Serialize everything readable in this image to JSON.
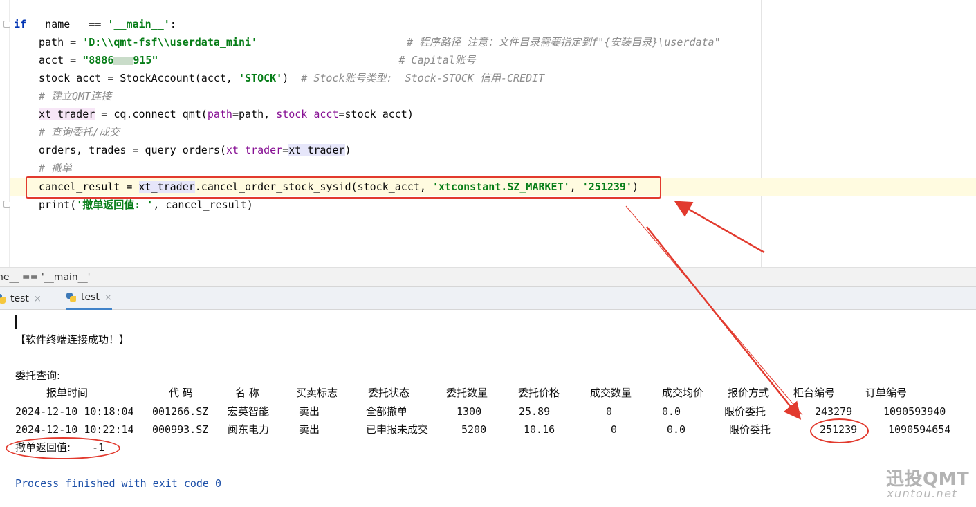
{
  "editor": {
    "line1": {
      "kw": "if",
      "mid": " __name__ == ",
      "str": "'__main__'",
      "tail": ":"
    },
    "line2": {
      "pre": "path = ",
      "str": "'D:\\\\qmt-fsf\\\\userdata_mini'",
      "comment": "# 程序路径 注意：文件目录需要指定到f\"{安装目录}\\userdata\""
    },
    "line3": {
      "pre": "acct = ",
      "str_a": "\"8886",
      "str_b": "915\"",
      "comment": "# Capital账号"
    },
    "line4": {
      "pre": "stock_acct = StockAccount(acct, ",
      "str": "'STOCK'",
      "mid": ")  ",
      "comment": "# Stock账号类型:  Stock-STOCK 信用-CREDIT"
    },
    "line5": {
      "comment": "# 建立QMT连接"
    },
    "line6": {
      "var": "xt_trader",
      "a": " = cq.connect_qmt(",
      "p1": "path",
      "b": "=path, ",
      "p2": "stock_acct",
      "c": "=stock_acct)"
    },
    "line7": {
      "comment": "# 查询委托/成交"
    },
    "line8": {
      "a": "orders, trades = query_orders(",
      "p1": "xt_trader",
      "b": "=",
      "v": "xt_trader",
      "c": ")"
    },
    "line9": {
      "comment": "# 撤单"
    },
    "line10": {
      "a": "cancel_result = ",
      "v": "xt_trader",
      "b": ".cancel_order_stock_sysid(stock_acct, ",
      "s1": "'xtconstant.SZ_MARKET'",
      "c": ", ",
      "s2": "'251239'",
      "d": ")"
    },
    "line11": {
      "a": "print(",
      "s": "'撤单返回值: '",
      "b": ", cancel_result)"
    }
  },
  "breadcrumb": {
    "text": "ne__ == '__main__'"
  },
  "run_tabs": [
    {
      "label": "test",
      "close": "×"
    },
    {
      "label": "test",
      "close": "×"
    }
  ],
  "console": {
    "connect_msg": "【软件终端连接成功！】",
    "query_title": "委托查询:",
    "headers": [
      "报单时间",
      "代 码",
      "名 称",
      "买卖标志",
      "委托状态",
      "委托数量",
      "委托价格",
      "成交数量",
      "成交均价",
      "报价方式",
      "柜台编号",
      "订单编号"
    ],
    "rows": [
      [
        "2024-12-10 10:18:04",
        "001266.SZ",
        "宏英智能",
        "卖出",
        "全部撤单",
        "1300",
        "25.89",
        "0",
        "0.0",
        "限价委托",
        "243279",
        "1090593940"
      ],
      [
        "2024-12-10 10:22:14",
        "000993.SZ",
        "闽东电力",
        "卖出",
        "已申报未成交",
        "5200",
        "10.16",
        "0",
        "0.0",
        "限价委托",
        "251239",
        "1090594654"
      ]
    ],
    "result_label": "撤单返回值:",
    "result_value": "-1",
    "finished": "Process finished with exit code 0"
  },
  "watermark": {
    "brand": "迅投QMT",
    "site": "xuntou.net"
  },
  "colors": {
    "annotation_red": "#e23a2e",
    "keyword": "#0033b3",
    "string": "#067d17",
    "comment": "#8c8c8c",
    "param": "#871094"
  }
}
